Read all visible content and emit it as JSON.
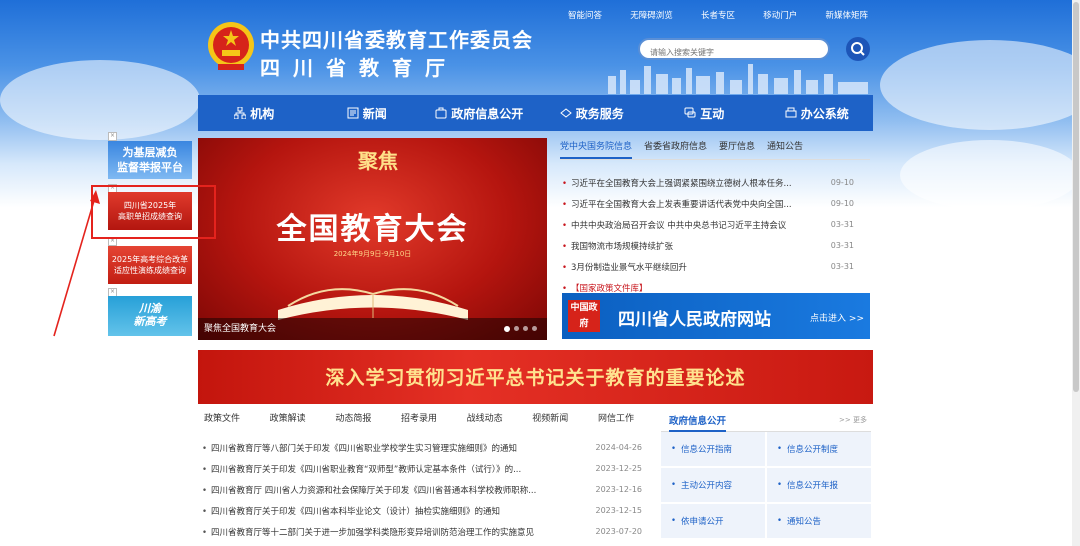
{
  "top_links": [
    "智能问答",
    "无障碍浏览",
    "长者专区",
    "移动门户",
    "新媒体矩阵"
  ],
  "header": {
    "title_line1": "中共四川省委教育工作委员会",
    "title_line2": "四川省教育厅"
  },
  "search": {
    "placeholder": "请输入搜索关键字"
  },
  "nav": [
    {
      "label": "机构",
      "icon": "org-icon"
    },
    {
      "label": "新闻",
      "icon": "news-icon"
    },
    {
      "label": "政府信息公开",
      "icon": "info-icon"
    },
    {
      "label": "政务服务",
      "icon": "service-icon"
    },
    {
      "label": "互动",
      "icon": "chat-icon"
    },
    {
      "label": "办公系统",
      "icon": "office-icon"
    }
  ],
  "floaters": {
    "f1": "为基层减负\n监督举报平台",
    "f2": "四川省2025年\n高职单招成绩查询",
    "f3": "2025年高考综合改革\n适应性演练成绩查询",
    "f4": "川渝\n新高考"
  },
  "banner": {
    "small": "聚焦",
    "big": "全国教育大会",
    "date": "2024年9月9日-9月10日",
    "caption": "聚焦全国教育大会"
  },
  "news_tabs": [
    "党中央国务院信息",
    "省委省政府信息",
    "要厅信息",
    "通知公告"
  ],
  "news": [
    {
      "title": "习近平在全国教育大会上强调紧紧围绕立德树人根本任务...",
      "date": "09-10"
    },
    {
      "title": "习近平在全国教育大会上发表重要讲话代表党中央向全国...",
      "date": "09-10"
    },
    {
      "title": "中共中央政治局召开会议 中共中央总书记习近平主持会议",
      "date": "03-31"
    },
    {
      "title": "我国物流市场规模持续扩张",
      "date": "03-31"
    },
    {
      "title": "3月份制造业景气水平继续回升",
      "date": "03-31"
    },
    {
      "title": "【国家政策文件库】",
      "date": ""
    }
  ],
  "gov_banner": {
    "seal": "中国政府",
    "title": "四川省人民政府网站",
    "go": "点击进入 >>"
  },
  "strip": "深入学习贯彻习近平总书记关于教育的重要论述",
  "bottom_tabs": [
    "政策文件",
    "政策解读",
    "动态简报",
    "招考录用",
    "战线动态",
    "视频新闻",
    "网信工作"
  ],
  "bottom_list": [
    {
      "title": "四川省教育厅等八部门关于印发《四川省职业学校学生实习管理实施细则》的通知",
      "date": "2024-04-26"
    },
    {
      "title": "四川省教育厅关于印发《四川省职业教育“双师型”教师认定基本条件（试行）》的...",
      "date": "2023-12-25"
    },
    {
      "title": "四川省教育厅 四川省人力资源和社会保障厅关于印发《四川省普通本科学校教师职称...",
      "date": "2023-12-16"
    },
    {
      "title": "四川省教育厅关于印发《四川省本科毕业论文（设计）抽检实施细则》的通知",
      "date": "2023-12-15"
    },
    {
      "title": "四川省教育厅等十二部门关于进一步加强学科类隐形变异培训防范治理工作的实施意见",
      "date": "2023-07-20"
    }
  ],
  "gov_open": {
    "title": "政府信息公开",
    "more": ">> 更多",
    "items": [
      "信息公开指南",
      "信息公开制度",
      "主动公开内容",
      "信息公开年报",
      "依申请公开",
      "通知公告"
    ]
  }
}
